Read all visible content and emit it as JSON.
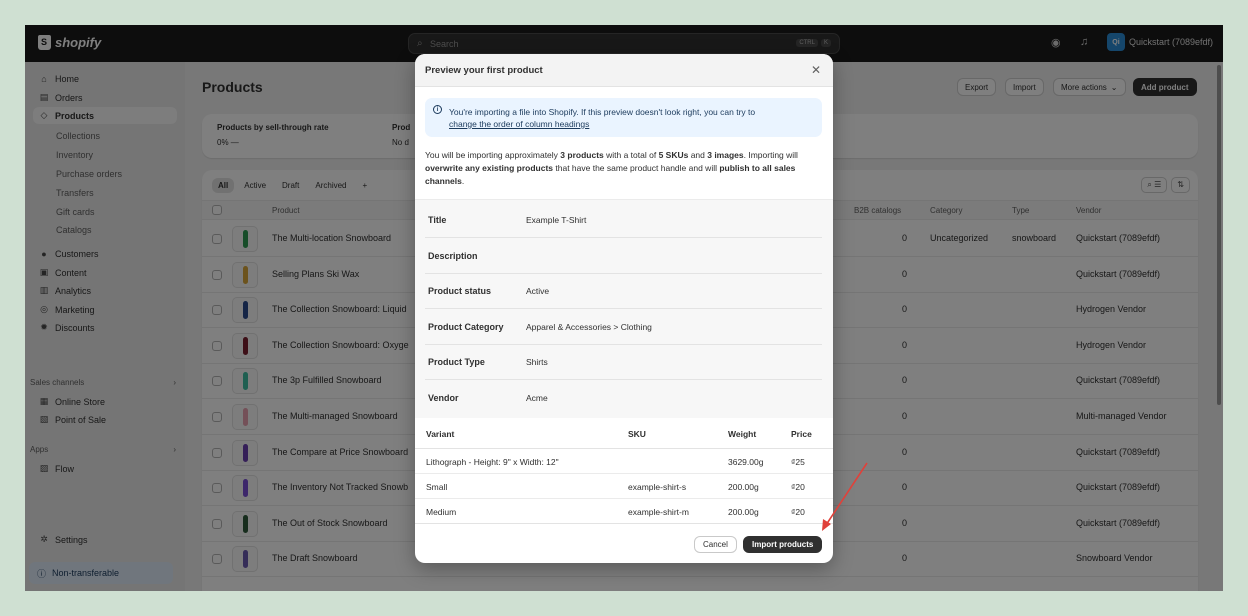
{
  "topbar": {
    "brand": "shopify",
    "search_placeholder": "Search",
    "shortcut_keys": [
      "CTRL",
      "K"
    ],
    "store_initials": "Qi",
    "store_name": "Quickstart (7089efdf)"
  },
  "sidebar": {
    "main_items": [
      {
        "label": "Home",
        "icon": "home-icon"
      },
      {
        "label": "Orders",
        "icon": "orders-icon"
      },
      {
        "label": "Products",
        "icon": "tag-icon"
      }
    ],
    "product_subitems": [
      "Collections",
      "Inventory",
      "Purchase orders",
      "Transfers",
      "Gift cards",
      "Catalogs"
    ],
    "more_items": [
      {
        "label": "Customers",
        "icon": "person-icon"
      },
      {
        "label": "Content",
        "icon": "content-icon"
      },
      {
        "label": "Analytics",
        "icon": "chart-icon"
      },
      {
        "label": "Marketing",
        "icon": "target-icon"
      },
      {
        "label": "Discounts",
        "icon": "discount-icon"
      }
    ],
    "sales_channels_label": "Sales channels",
    "sales_channels": [
      {
        "label": "Online Store",
        "icon": "store-icon"
      },
      {
        "label": "Point of Sale",
        "icon": "pos-icon"
      }
    ],
    "apps_label": "Apps",
    "apps": [
      {
        "label": "Flow",
        "icon": "flow-icon"
      }
    ],
    "settings_label": "Settings",
    "non_transferable_label": "Non-transferable"
  },
  "page": {
    "title": "Products",
    "actions": {
      "export": "Export",
      "import": "Import",
      "more": "More actions",
      "add": "Add product"
    },
    "stats": [
      {
        "label": "Products by sell-through rate",
        "value": "0% —"
      },
      {
        "label": "Prod",
        "value": "No d"
      }
    ],
    "filters": [
      "All",
      "Active",
      "Draft",
      "Archived",
      "+"
    ],
    "columns": {
      "product": "Product",
      "b2b": "B2B catalogs",
      "category": "Category",
      "type": "Type",
      "vendor": "Vendor"
    },
    "rows": [
      {
        "name": "The Multi-location Snowboard",
        "b2b": "0",
        "category": "Uncategorized",
        "type": "snowboard",
        "vendor": "Quickstart (7089efdf)",
        "color": "#2e9a53"
      },
      {
        "name": "Selling Plans Ski Wax",
        "b2b": "0",
        "category": "",
        "type": "",
        "vendor": "Quickstart (7089efdf)",
        "color": "#d8a63a"
      },
      {
        "name": "The Collection Snowboard: Liquid",
        "b2b": "0",
        "category": "",
        "type": "",
        "vendor": "Hydrogen Vendor",
        "color": "#2b4a8c"
      },
      {
        "name": "The Collection Snowboard: Oxyge",
        "b2b": "0",
        "category": "",
        "type": "",
        "vendor": "Hydrogen Vendor",
        "color": "#7a1f2e"
      },
      {
        "name": "The 3p Fulfilled Snowboard",
        "b2b": "0",
        "category": "",
        "type": "",
        "vendor": "Quickstart (7089efdf)",
        "color": "#3fbfa3"
      },
      {
        "name": "The Multi-managed Snowboard",
        "b2b": "0",
        "category": "",
        "type": "",
        "vendor": "Multi-managed Vendor",
        "color": "#e8a0b0"
      },
      {
        "name": "The Compare at Price Snowboard",
        "b2b": "0",
        "category": "",
        "type": "",
        "vendor": "Quickstart (7089efdf)",
        "color": "#6a3fb0"
      },
      {
        "name": "The Inventory Not Tracked Snowb",
        "b2b": "0",
        "category": "",
        "type": "",
        "vendor": "Quickstart (7089efdf)",
        "color": "#7b4fd6"
      },
      {
        "name": "The Out of Stock Snowboard",
        "b2b": "0",
        "category": "",
        "type": "",
        "vendor": "Quickstart (7089efdf)",
        "color": "#2f5a3a"
      },
      {
        "name": "The Draft Snowboard",
        "b2b": "0",
        "category": "",
        "type": "",
        "vendor": "Snowboard Vendor",
        "color": "#6b5ab0"
      }
    ]
  },
  "modal": {
    "title": "Preview your first product",
    "banner_text": "You're importing a file into Shopify. If this preview doesn't look right, you can try to",
    "banner_link": "change the order of column headings",
    "summary": {
      "t1": "You will be importing approximately ",
      "products": "3 products",
      "t2": " with a total of ",
      "skus": "5 SKUs",
      "t3": " and ",
      "images": "3 images",
      "t4": ". Importing will ",
      "overwrite": "overwrite any existing products",
      "t5": " that have the same product handle and will ",
      "publish": "publish to all sales channels",
      "t6": "."
    },
    "fields": [
      {
        "label": "Title",
        "value": "Example T-Shirt"
      },
      {
        "label": "Description",
        "value": ""
      },
      {
        "label": "Product status",
        "value": "Active"
      },
      {
        "label": "Product Category",
        "value": "Apparel & Accessories > Clothing"
      },
      {
        "label": "Product Type",
        "value": "Shirts"
      },
      {
        "label": "Vendor",
        "value": "Acme"
      }
    ],
    "variant_columns": {
      "variant": "Variant",
      "sku": "SKU",
      "weight": "Weight",
      "price": "Price"
    },
    "variants": [
      {
        "variant": "Lithograph - Height: 9\" x Width: 12\"",
        "sku": "",
        "weight": "3629.00g",
        "price": "₫25"
      },
      {
        "variant": "Small",
        "sku": "example-shirt-s",
        "weight": "200.00g",
        "price": "₫20"
      },
      {
        "variant": "Medium",
        "sku": "example-shirt-m",
        "weight": "200.00g",
        "price": "₫20"
      }
    ],
    "cancel_label": "Cancel",
    "import_label": "Import products"
  },
  "colors": {
    "annotation_arrow": "#e0413a",
    "primary_button": "#303030",
    "banner_bg": "#eaf4ff"
  }
}
